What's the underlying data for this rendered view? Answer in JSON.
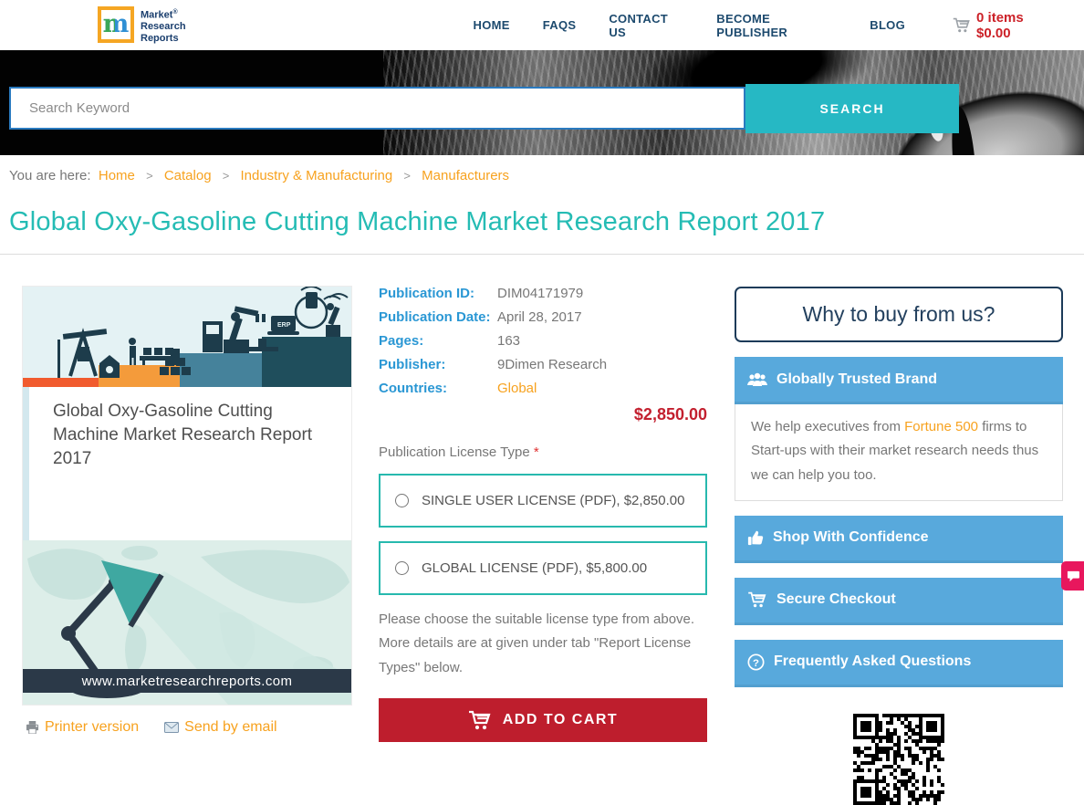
{
  "colors": {
    "accent_teal": "#26b8c4",
    "title_teal": "#25bcb4",
    "orange_link": "#f7a21f",
    "nav_navy": "#1d4a6e",
    "label_blue": "#2a97d4",
    "price_red": "#c3202f",
    "button_red": "#be1e2d",
    "box_blue": "#58a9dc",
    "license_border_teal": "#27b9ae",
    "chat_pink": "#e8175d"
  },
  "header": {
    "logo": {
      "mark": "m",
      "line1": "Market",
      "line2": "Research",
      "line3": "Reports",
      "registered": "®"
    },
    "nav": {
      "items": [
        {
          "label": "HOME"
        },
        {
          "label": "FAQS"
        },
        {
          "label": "CONTACT US"
        },
        {
          "label": "BECOME PUBLISHER"
        },
        {
          "label": "BLOG"
        }
      ]
    },
    "cart": {
      "icon": "cart-icon",
      "label": "0 items $0.00"
    }
  },
  "search": {
    "placeholder": "Search Keyword",
    "button_label": "SEARCH"
  },
  "breadcrumb": {
    "prefix": "You are here:",
    "separator": ">",
    "items": [
      {
        "label": "Home"
      },
      {
        "label": "Catalog"
      },
      {
        "label": "Industry & Manufacturing"
      },
      {
        "label": "Manufacturers"
      }
    ]
  },
  "page": {
    "title": "Global Oxy-Gasoline Cutting Machine Market Research Report 2017"
  },
  "product": {
    "cover": {
      "title": "Global Oxy-Gasoline Cutting Machine Market Research Report 2017",
      "website": "www.marketresearchreports.com"
    },
    "actions": {
      "printer": "Printer version",
      "email": "Send by email"
    },
    "details": [
      {
        "label": "Publication ID:",
        "value": "DIM04171979"
      },
      {
        "label": "Publication Date:",
        "value": "April 28, 2017"
      },
      {
        "label": "Pages:",
        "value": "163"
      },
      {
        "label": "Publisher:",
        "value": "9Dimen Research"
      },
      {
        "label": "Countries:",
        "value": "Global"
      }
    ],
    "price": "$2,850.00",
    "license": {
      "label": "Publication License Type",
      "required_mark": "*",
      "options": [
        {
          "label": "SINGLE USER LICENSE (PDF), $2,850.00"
        },
        {
          "label": "GLOBAL LICENSE (PDF), $5,800.00"
        }
      ]
    },
    "note": "Please choose the suitable license type from above. More details are at given under tab \"Report License Types\" below.",
    "add_to_cart_label": "ADD TO CART"
  },
  "sidebar": {
    "why_title": "Why to buy from us?",
    "trusted": {
      "icon": "users-icon",
      "title": "Globally Trusted Brand",
      "body_prefix": "We help executives from ",
      "body_link": "Fortune 500",
      "body_suffix": " firms to Start-ups with their market research needs thus we can help you too."
    },
    "boxes": [
      {
        "icon": "thumbs-up-icon",
        "label": "Shop With Confidence"
      },
      {
        "icon": "cart-icon",
        "label": "Secure Checkout"
      },
      {
        "icon": "question-icon",
        "label": "Frequently Asked Questions"
      }
    ]
  },
  "chat": {
    "icon": "chat-bubble-icon"
  }
}
